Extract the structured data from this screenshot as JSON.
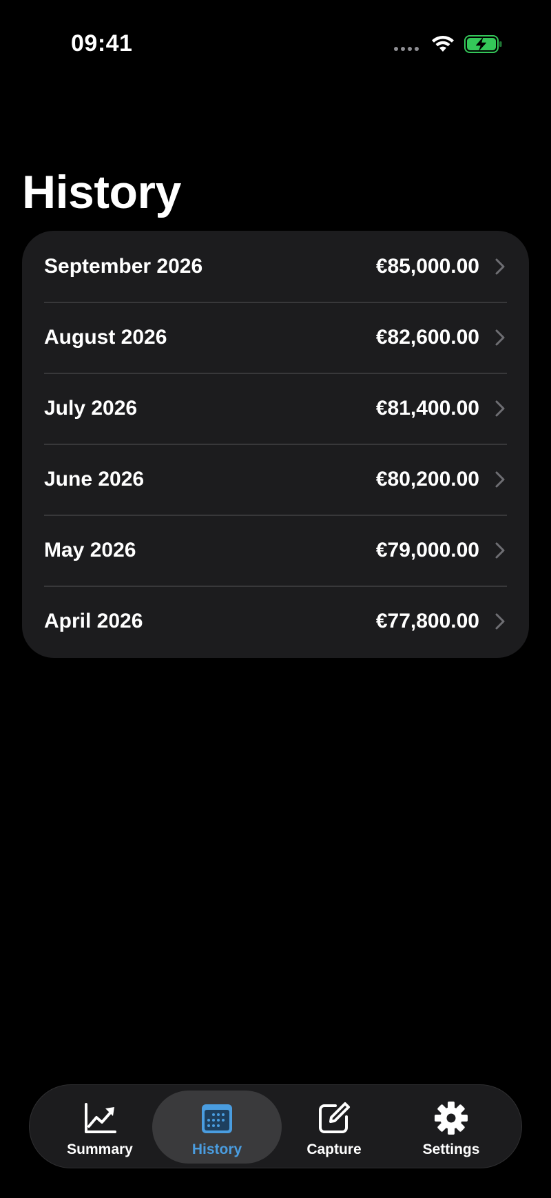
{
  "status_bar": {
    "time": "09:41"
  },
  "title": "History",
  "history": [
    {
      "month": "September 2026",
      "amount": "€85,000.00"
    },
    {
      "month": "August 2026",
      "amount": "€82,600.00"
    },
    {
      "month": "July 2026",
      "amount": "€81,400.00"
    },
    {
      "month": "June 2026",
      "amount": "€80,200.00"
    },
    {
      "month": "May 2026",
      "amount": "€79,000.00"
    },
    {
      "month": "April 2026",
      "amount": "€77,800.00"
    }
  ],
  "tabs": [
    {
      "label": "Summary",
      "icon": "chart-line-icon",
      "active": false
    },
    {
      "label": "History",
      "icon": "calendar-icon",
      "active": true
    },
    {
      "label": "Capture",
      "icon": "square-pencil-icon",
      "active": false
    },
    {
      "label": "Settings",
      "icon": "gear-icon",
      "active": false
    }
  ],
  "colors": {
    "background": "#000000",
    "card": "#1c1c1e",
    "accent": "#4a9de0",
    "battery": "#34c759"
  }
}
